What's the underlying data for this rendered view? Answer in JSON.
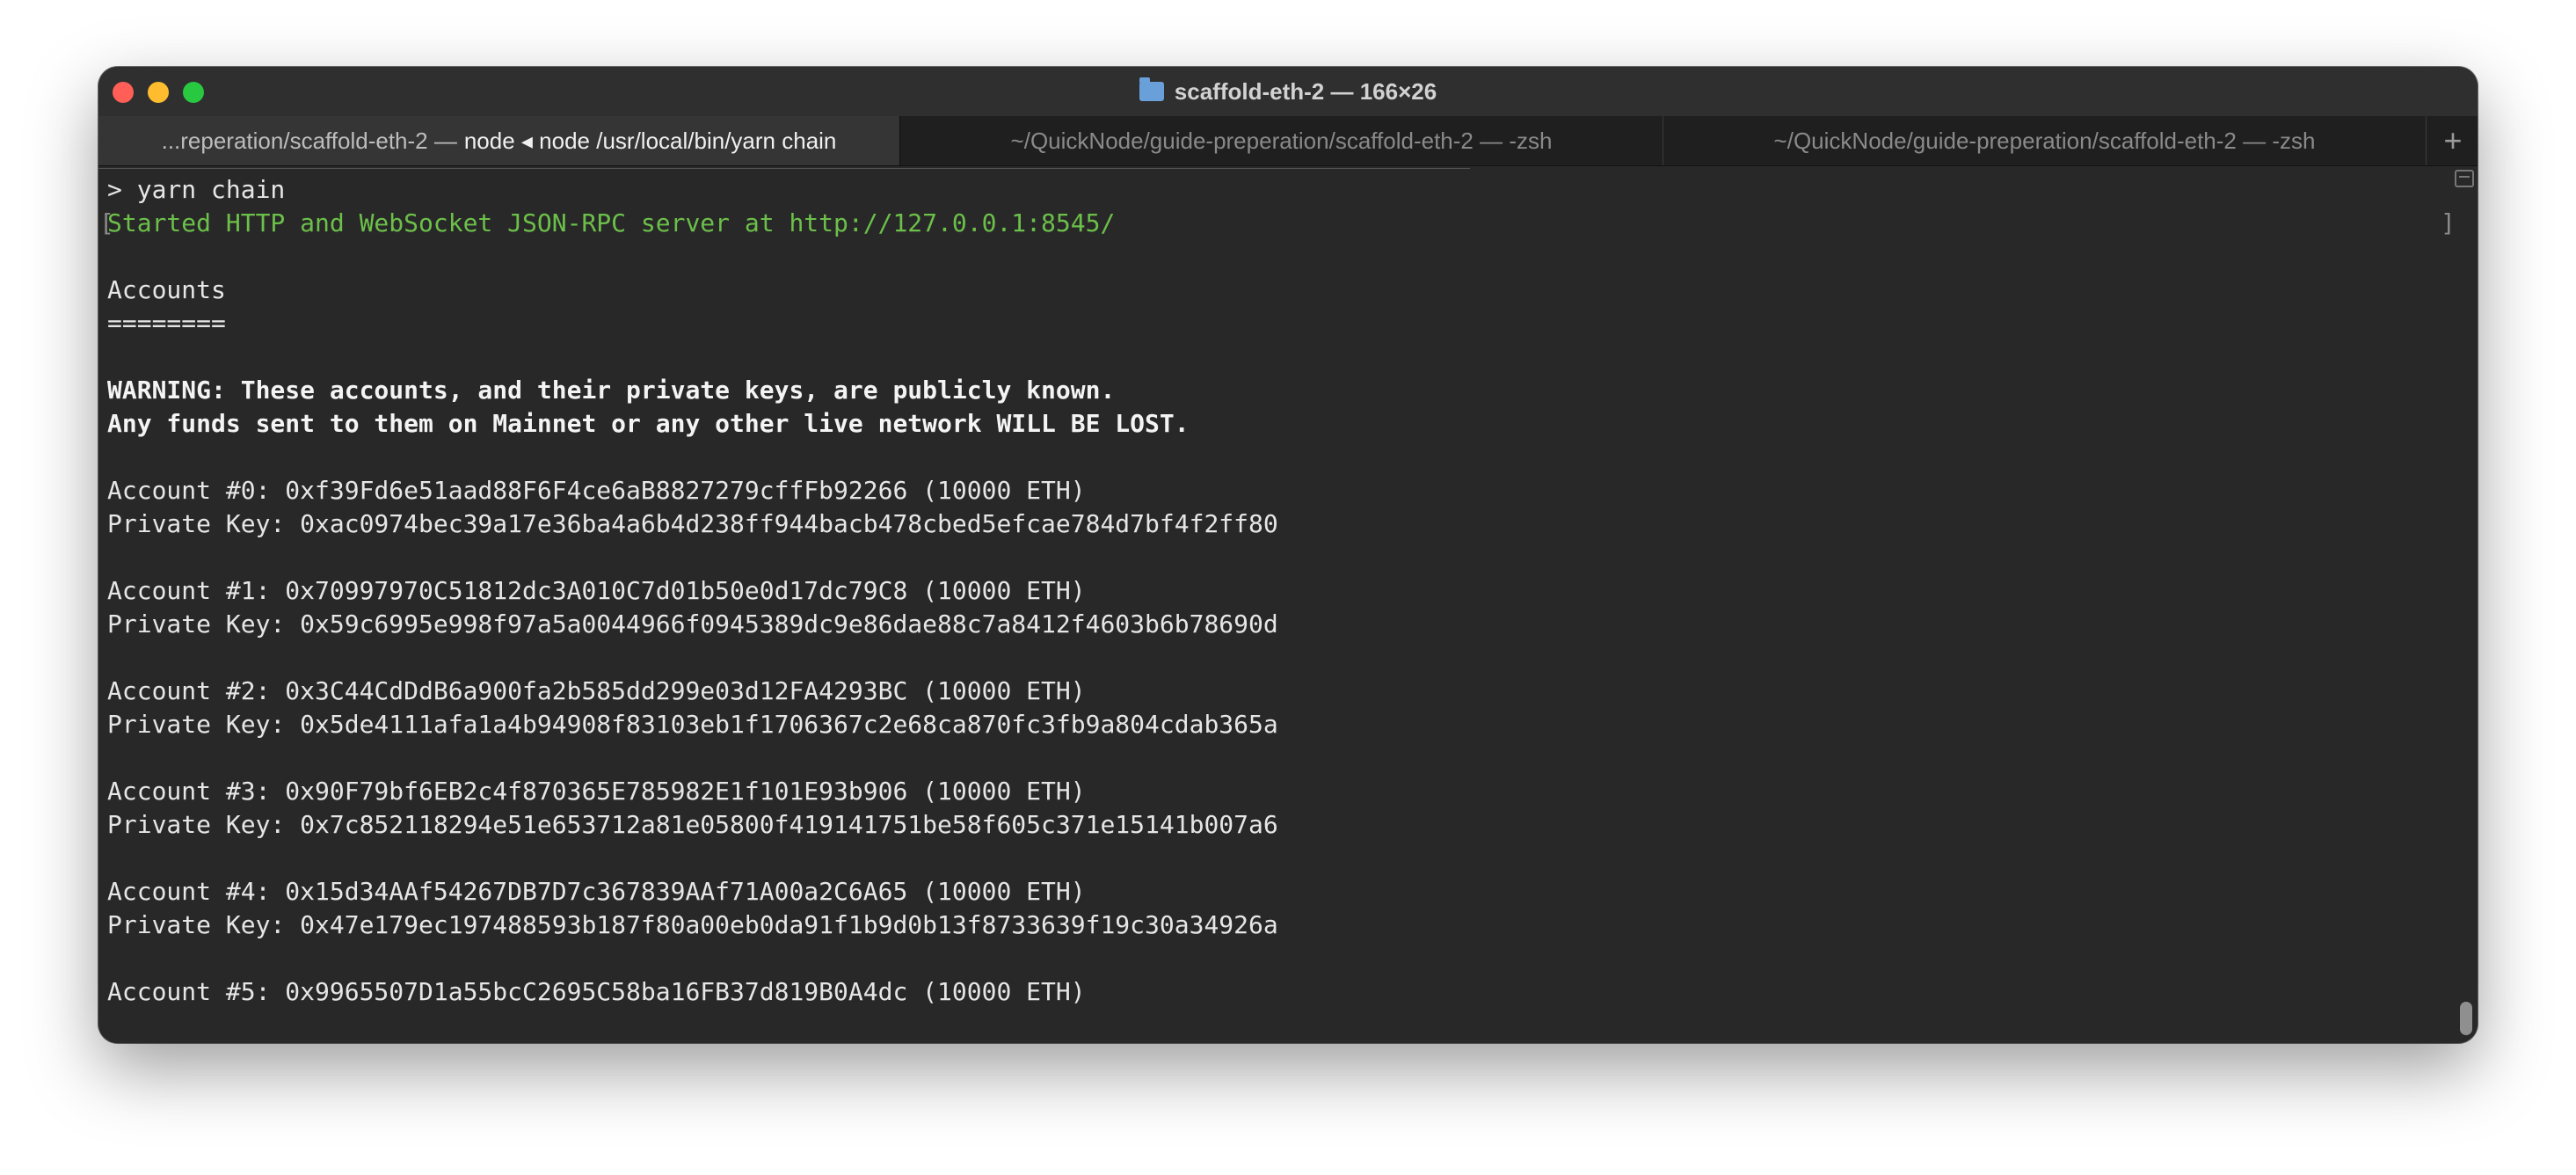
{
  "window": {
    "title": "scaffold-eth-2 — 166×26"
  },
  "tabs": [
    {
      "prefix": "...reperation/scaffold-eth-2 —",
      "bright": "node ◂ node /usr/local/bin/yarn chain",
      "active": true
    },
    {
      "label": "~/QuickNode/guide-preperation/scaffold-eth-2 — -zsh",
      "active": false
    },
    {
      "label": "~/QuickNode/guide-preperation/scaffold-eth-2 — -zsh",
      "active": false
    }
  ],
  "new_tab_label": "+",
  "terminal": {
    "left_bracket": "[",
    "right_bracket": "]",
    "lines": [
      "> yarn chain",
      "Started HTTP and WebSocket JSON-RPC server at http://127.0.0.1:8545/",
      "",
      "Accounts",
      "========",
      "",
      "WARNING: These accounts, and their private keys, are publicly known.",
      "Any funds sent to them on Mainnet or any other live network WILL BE LOST.",
      "",
      "Account #0: 0xf39Fd6e51aad88F6F4ce6aB8827279cffFb92266 (10000 ETH)",
      "Private Key: 0xac0974bec39a17e36ba4a6b4d238ff944bacb478cbed5efcae784d7bf4f2ff80",
      "",
      "Account #1: 0x70997970C51812dc3A010C7d01b50e0d17dc79C8 (10000 ETH)",
      "Private Key: 0x59c6995e998f97a5a0044966f0945389dc9e86dae88c7a8412f4603b6b78690d",
      "",
      "Account #2: 0x3C44CdDdB6a900fa2b585dd299e03d12FA4293BC (10000 ETH)",
      "Private Key: 0x5de4111afa1a4b94908f83103eb1f1706367c2e68ca870fc3fb9a804cdab365a",
      "",
      "Account #3: 0x90F79bf6EB2c4f870365E785982E1f101E93b906 (10000 ETH)",
      "Private Key: 0x7c852118294e51e653712a81e05800f419141751be58f605c371e15141b007a6",
      "",
      "Account #4: 0x15d34AAf54267DB7D7c367839AAf71A00a2C6A65 (10000 ETH)",
      "Private Key: 0x47e179ec197488593b187f80a00eb0da91f1b9d0b13f8733639f19c30a34926a",
      "",
      "Account #5: 0x9965507D1a55bcC2695C58ba16FB37d819B0A4dc (10000 ETH)"
    ]
  },
  "colors": {
    "server_line": "#6cc04a",
    "close": "#ff5f57",
    "minimize": "#febc2e",
    "zoom": "#28c840"
  }
}
